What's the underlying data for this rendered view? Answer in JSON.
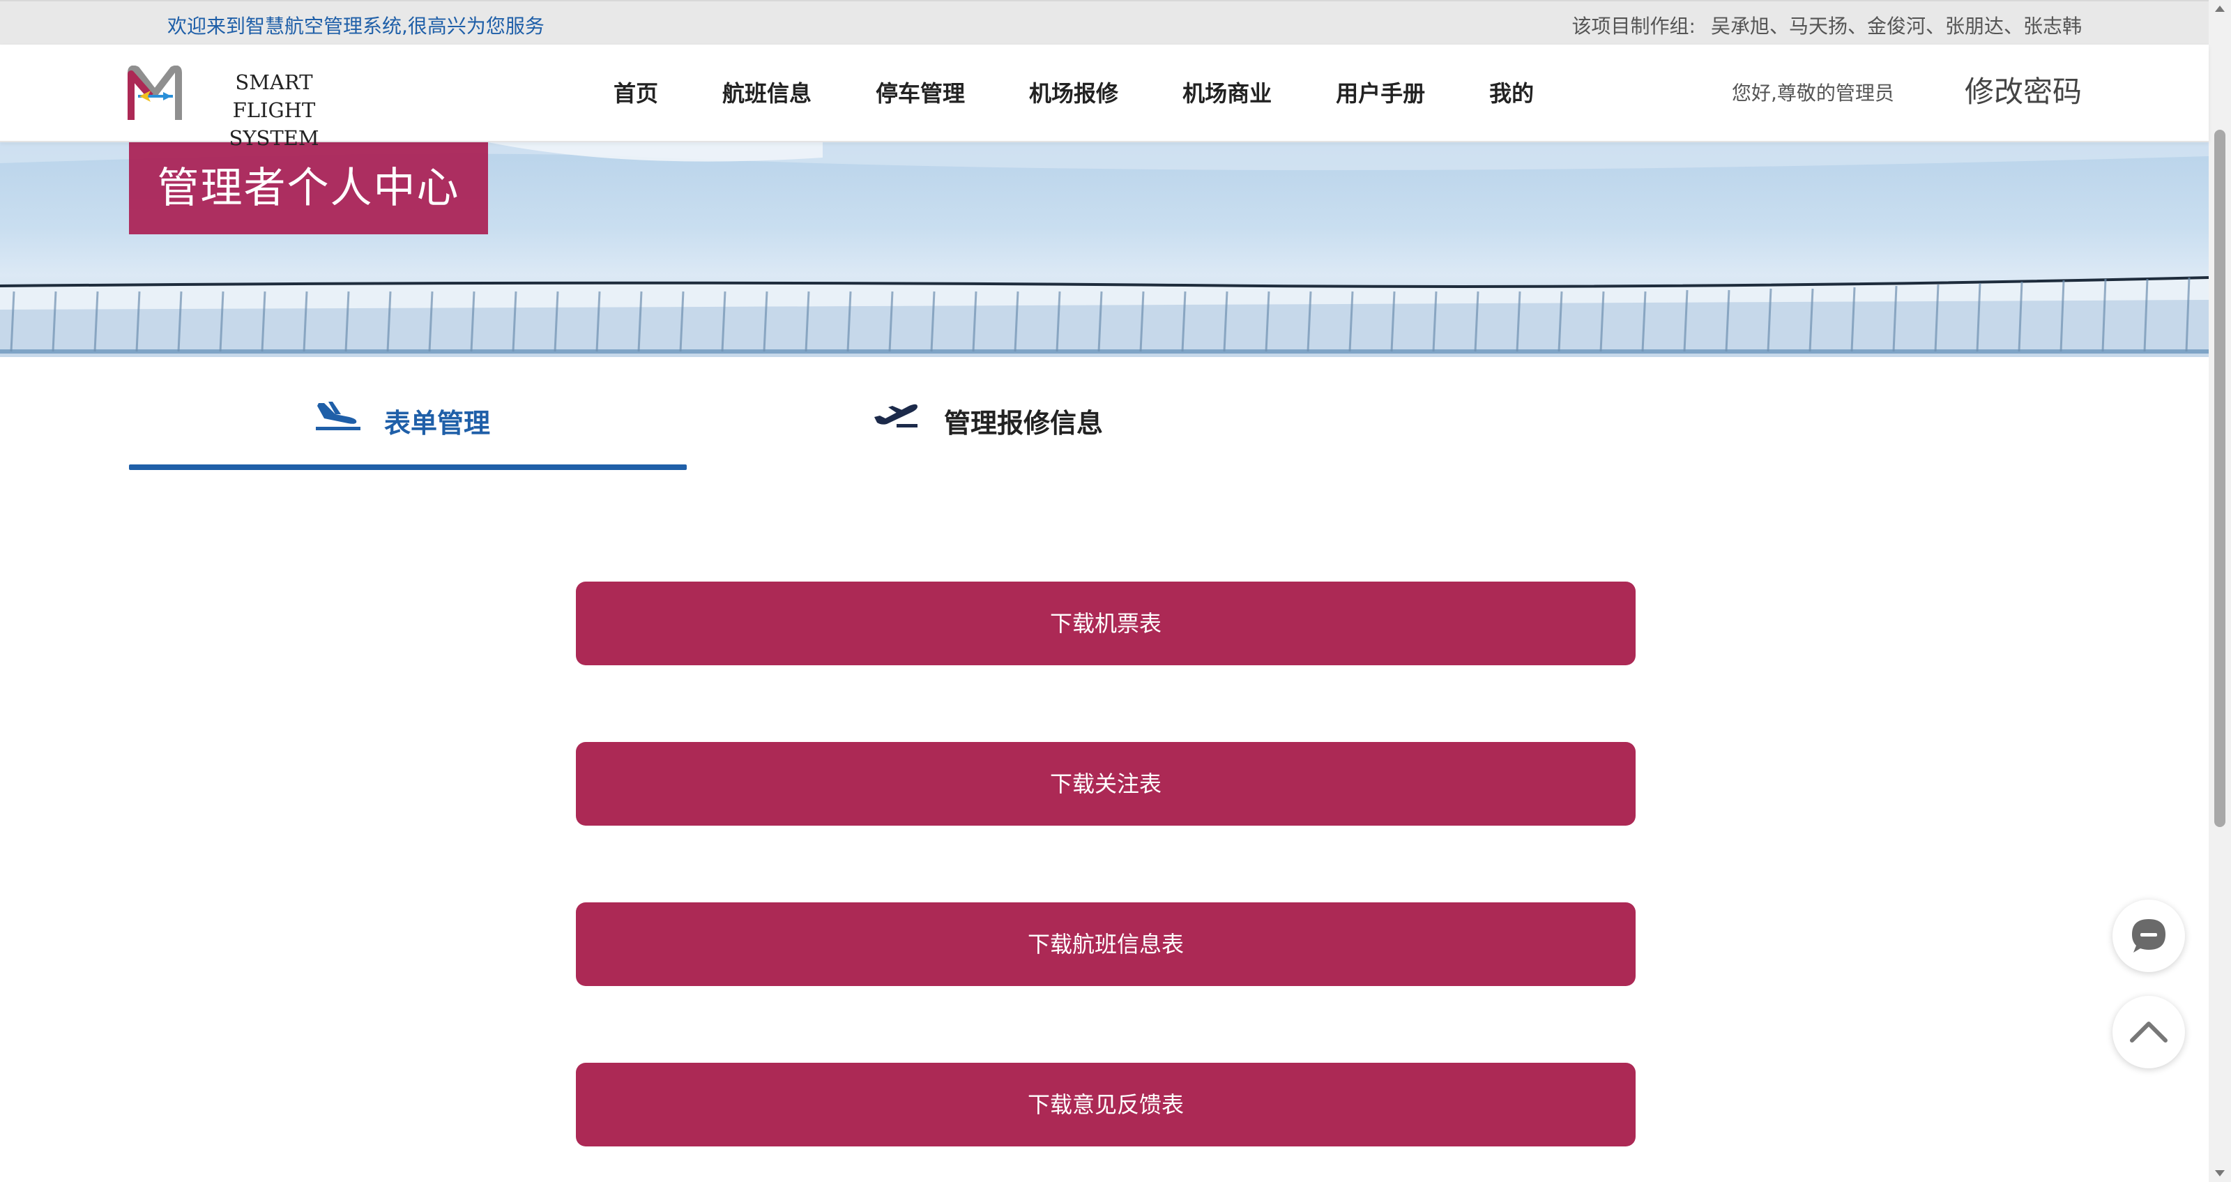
{
  "topbar": {
    "welcome": "欢迎来到智慧航空管理系统,很高兴为您服务",
    "team_label": "该项目制作组:",
    "team_names": "吴承旭、马天扬、金俊河、张朋达、张志韩"
  },
  "header": {
    "logo_line1": "SMART FLIGHT",
    "logo_line2": "SYSTEM",
    "nav": [
      "首页",
      "航班信息",
      "停车管理",
      "机场报修",
      "机场商业",
      "用户手册",
      "我的"
    ],
    "greeting": "您好,尊敬的管理员",
    "change_password": "修改密码"
  },
  "banner": {
    "title": "管理者个人中心"
  },
  "tabs": {
    "forms": "表单管理",
    "repair": "管理报修信息",
    "active": "forms"
  },
  "downloads": [
    "下载机票表",
    "下载关注表",
    "下载航班信息表",
    "下载意见反馈表"
  ],
  "colors": {
    "accent_blue": "#1f5fa8",
    "button_magenta": "#ac2955",
    "banner_title_bg": "#aa2054"
  },
  "icons": {
    "chat": "chat-bubble-icon",
    "back_to_top": "chevron-up-icon",
    "forms_tab": "plane-landing-icon",
    "repair_tab": "plane-takeoff-icon"
  }
}
